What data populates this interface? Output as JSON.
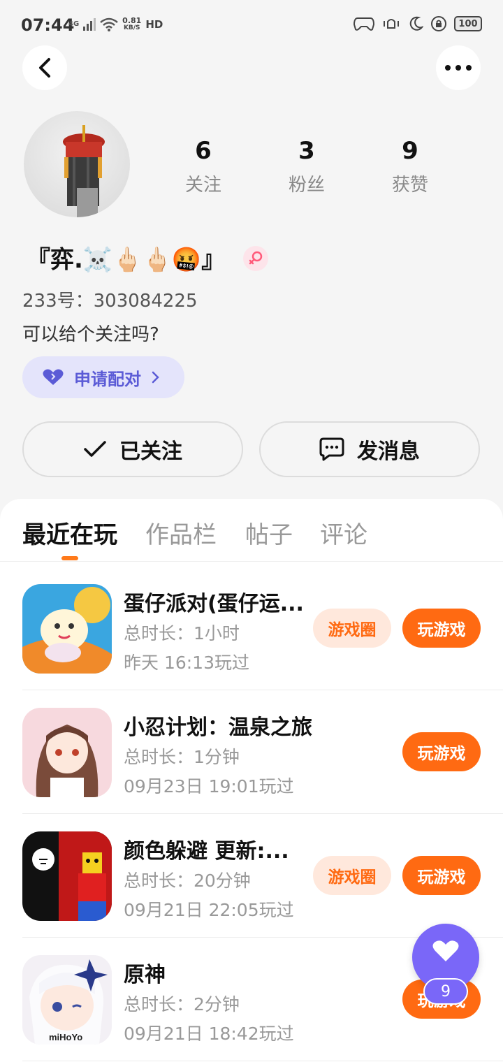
{
  "status_bar": {
    "time": "07:44",
    "network": "4G",
    "speed_value": "0.81",
    "speed_unit": "KB/S",
    "hd": "HD",
    "battery": "100"
  },
  "profile": {
    "stats": [
      {
        "value": "6",
        "label": "关注"
      },
      {
        "value": "3",
        "label": "粉丝"
      },
      {
        "value": "9",
        "label": "获赞"
      }
    ],
    "username": "『弈.☠️🖕🏻🖕🏻🤬』",
    "uid": "233号：303084225",
    "bio": "可以给个关注吗?",
    "pair_label": "申请配对",
    "follow_label": "已关注",
    "message_label": "发消息"
  },
  "tabs": [
    "最近在玩",
    "作品栏",
    "帖子",
    "评论"
  ],
  "games": [
    {
      "title": "蛋仔派对(蛋仔运...",
      "duration": "总时长：1小时",
      "last_played": "昨天 16:13玩过",
      "circle_label": "游戏圈",
      "play_label": "玩游戏"
    },
    {
      "title": "小忍计划：温泉之旅",
      "duration": "总时长：1分钟",
      "last_played": "09月23日 19:01玩过",
      "circle_label": "",
      "play_label": "玩游戏"
    },
    {
      "title": "颜色躲避 更新:...",
      "duration": "总时长：20分钟",
      "last_played": "09月21日 22:05玩过",
      "circle_label": "游戏圈",
      "play_label": "玩游戏"
    },
    {
      "title": "原神",
      "duration": "总时长：2分钟",
      "last_played": "09月21日 18:42玩过",
      "circle_label": "",
      "play_label": "玩游戏",
      "icon_text": "miHoYo"
    }
  ],
  "floating_like": {
    "count": "9"
  },
  "colors": {
    "accent": "#ff6a12",
    "pair": "#5b5bd6",
    "like_fab": "#7a67f8"
  },
  "icons": [
    "back-arrow-icon",
    "more-dots-icon",
    "female-icon",
    "heart-icon",
    "check-icon",
    "chat-bubble-icon",
    "chevron-right-icon"
  ]
}
